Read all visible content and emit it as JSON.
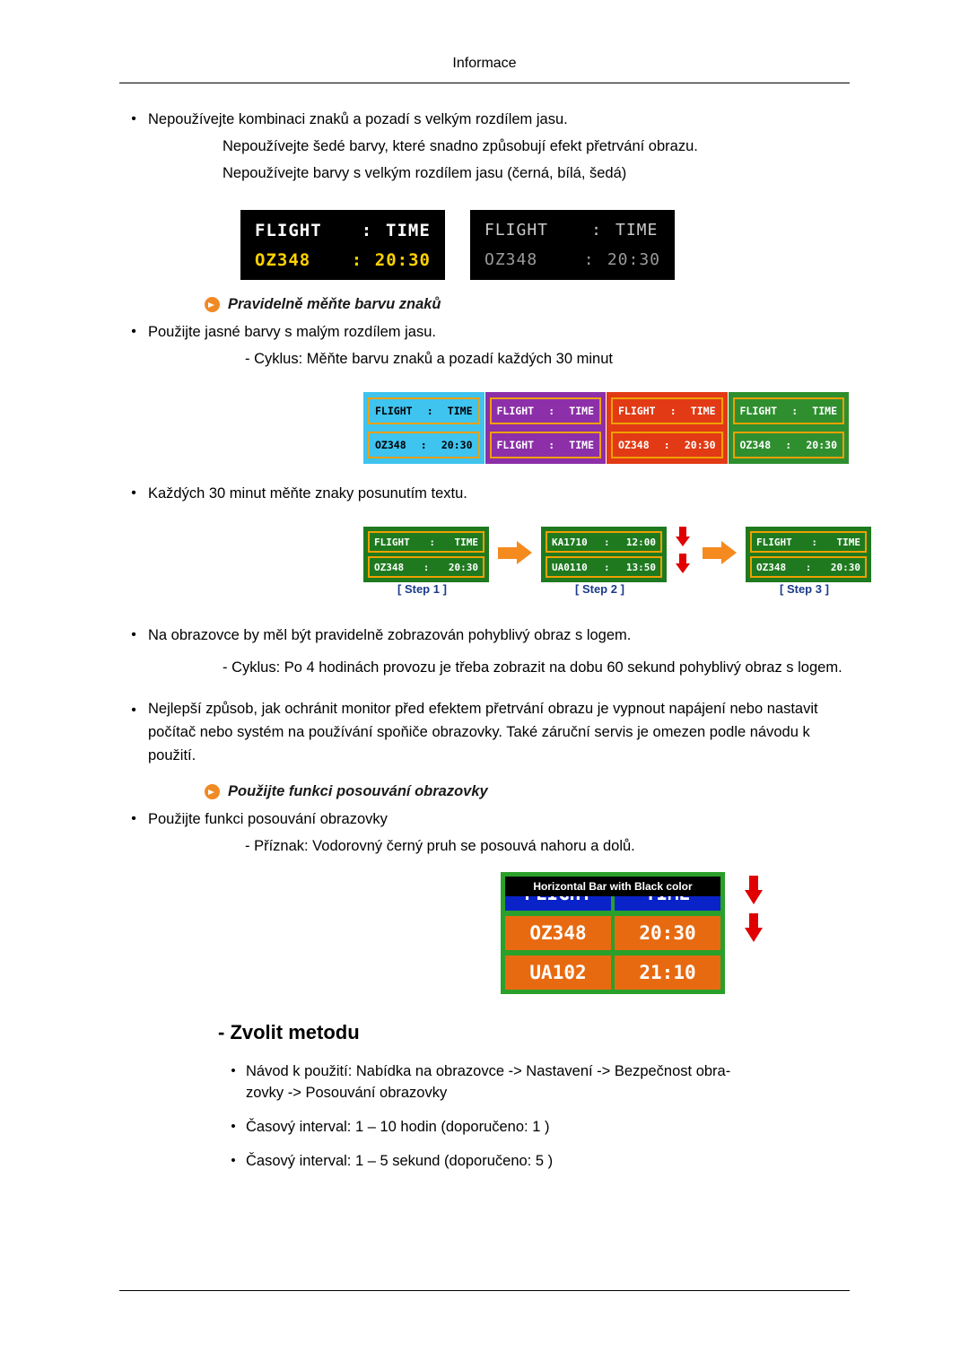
{
  "header": {
    "title": "Informace"
  },
  "intro": {
    "bullet1": "Nepoužívejte kombinaci znaků a pozadí s velkým rozdílem jasu.",
    "line2": "Nepoužívejte šedé barvy, které snadno způsobují efekt přetrvání obrazu.",
    "line3": "Nepoužívejte barvy s velkým rozdílem jasu (černá, bílá, šedá)"
  },
  "boards": {
    "dark": {
      "label": "FLIGHT",
      "sep": ":",
      "time_label": "TIME",
      "flight": "OZ348",
      "sep2": ":",
      "time": "20:30"
    },
    "gray": {
      "label": "FLIGHT",
      "sep": ":",
      "time_label": "TIME",
      "flight": "OZ348",
      "sep2": ":",
      "time": "20:30"
    }
  },
  "section_change_color": {
    "heading": "Pravidelně měňte barvu znaků",
    "bullet": "Použijte jasné barvy s malým rozdílem jasu.",
    "sub": "- Cyklus: Měňte barvu znaků a pozadí každých 30 minut"
  },
  "color_panels": [
    {
      "name": "cyan-panel",
      "row1_left": "FLIGHT",
      "row1_sep": ":",
      "row1_right": "TIME",
      "row2_left": "OZ348",
      "row2_sep": ":",
      "row2_right": "20:30"
    },
    {
      "name": "purple-panel",
      "row1_left": "FLIGHT",
      "row1_sep": ":",
      "row1_right": "TIME",
      "row2_left": "FLIGHT",
      "row2_sep": ":",
      "row2_right": "TIME"
    },
    {
      "name": "red-panel",
      "row1_left": "FLIGHT",
      "row1_sep": ":",
      "row1_right": "TIME",
      "row2_left": "OZ348",
      "row2_sep": ":",
      "row2_right": "20:30"
    },
    {
      "name": "green-panel",
      "row1_left": "FLIGHT",
      "row1_sep": ":",
      "row1_right": "TIME",
      "row2_left": "OZ348",
      "row2_sep": ":",
      "row2_right": "20:30"
    }
  ],
  "section_shift_text": {
    "bullet": "Každých 30 minut měňte znaky posunutím textu.",
    "steps": [
      {
        "label": "[ Step 1 ]",
        "row1_left": "FLIGHT",
        "row1_sep": ":",
        "row1_right": "TIME",
        "row2_left": "OZ348",
        "row2_sep": ":",
        "row2_right": "20:30"
      },
      {
        "label": "[ Step 2 ]",
        "row1_left": "KA1710",
        "row1_sep": ":",
        "row1_right": "12:00",
        "row2_left": "UA0110",
        "row2_sep": ":",
        "row2_right": "13:50"
      },
      {
        "label": "[ Step 3 ]",
        "row1_left": "FLIGHT",
        "row1_sep": ":",
        "row1_right": "TIME",
        "row2_left": "OZ348",
        "row2_sep": ":",
        "row2_right": "20:30"
      }
    ]
  },
  "section_logo": {
    "bullet": "Na obrazovce by měl být pravidelně zobrazován pohyblivý obraz s logem.",
    "sub": "- Cyklus: Po 4 hodinách provozu je třeba zobrazit na dobu 60 sekund pohyblivý obraz s logem."
  },
  "section_power": {
    "bullet": "Nejlepší způsob, jak ochránit monitor před efektem přetrvání obrazu je vypnout napájení nebo nastavit počítač nebo systém na používání spoňiče obrazovky. Také záruční servis je omezen podle návodu k použití."
  },
  "section_scroll": {
    "heading": "Použijte funkci posouvání obrazovky",
    "bullet": "Použijte funkci posouvání obrazovky",
    "sub": "- Příznak: Vodorovný černý pruh se posouvá nahoru a dolů."
  },
  "hbar_figure": {
    "caption": "Horizontal Bar with Black color",
    "row1_left": "FLIGHT",
    "row1_right": "TIME",
    "row2_left": "OZ348",
    "row2_right": "20:30",
    "row3_left": "UA102",
    "row3_right": "21:10"
  },
  "method": {
    "title": "- Zvolit metodu",
    "items": [
      "Návod k použití: Nabídka na obrazovce -> Nastavení -> Bezpečnost obra-",
      "zovky -> Posouvání obrazovky",
      "Časový interval: 1 – 10 hodin (doporučeno: 1 )",
      "Časový interval: 1 – 5 sekund (doporučeno: 5 )"
    ]
  },
  "symbols": {
    "bullet": "•"
  },
  "colors": {
    "accent_orange": "#f08a24",
    "arrow_red": "#e00000",
    "step_label_blue": "#1a3a8a"
  }
}
